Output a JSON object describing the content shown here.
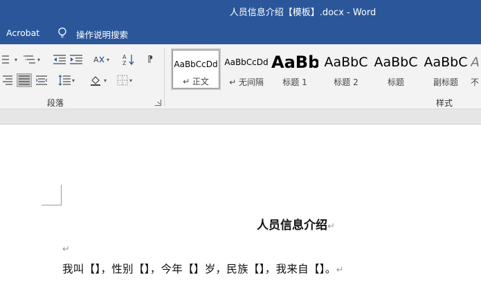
{
  "window": {
    "title": "人员信息介绍【模板】.docx  -  Word"
  },
  "menubar": {
    "acrobat": "Acrobat",
    "tell_me": "操作说明搜索"
  },
  "ribbon": {
    "paragraph_label": "段落",
    "styles_label": "样式",
    "styles": [
      {
        "preview": "AaBbCcDd",
        "name": "↵ 正文"
      },
      {
        "preview": "AaBbCcDd",
        "name": "↵ 无间隔"
      },
      {
        "preview": "AaBb",
        "name": "标题 1"
      },
      {
        "preview": "AaBbC",
        "name": "标题 2"
      },
      {
        "preview": "AaBbC",
        "name": "标题"
      },
      {
        "preview": "AaBbC",
        "name": "副标题"
      },
      {
        "preview": "A",
        "name": "不"
      }
    ]
  },
  "document": {
    "title": "人员信息介绍",
    "paragraph_mark": "↵",
    "body": "我叫【】，性别【】，今年【】岁，民族【】，我来自【】。"
  }
}
